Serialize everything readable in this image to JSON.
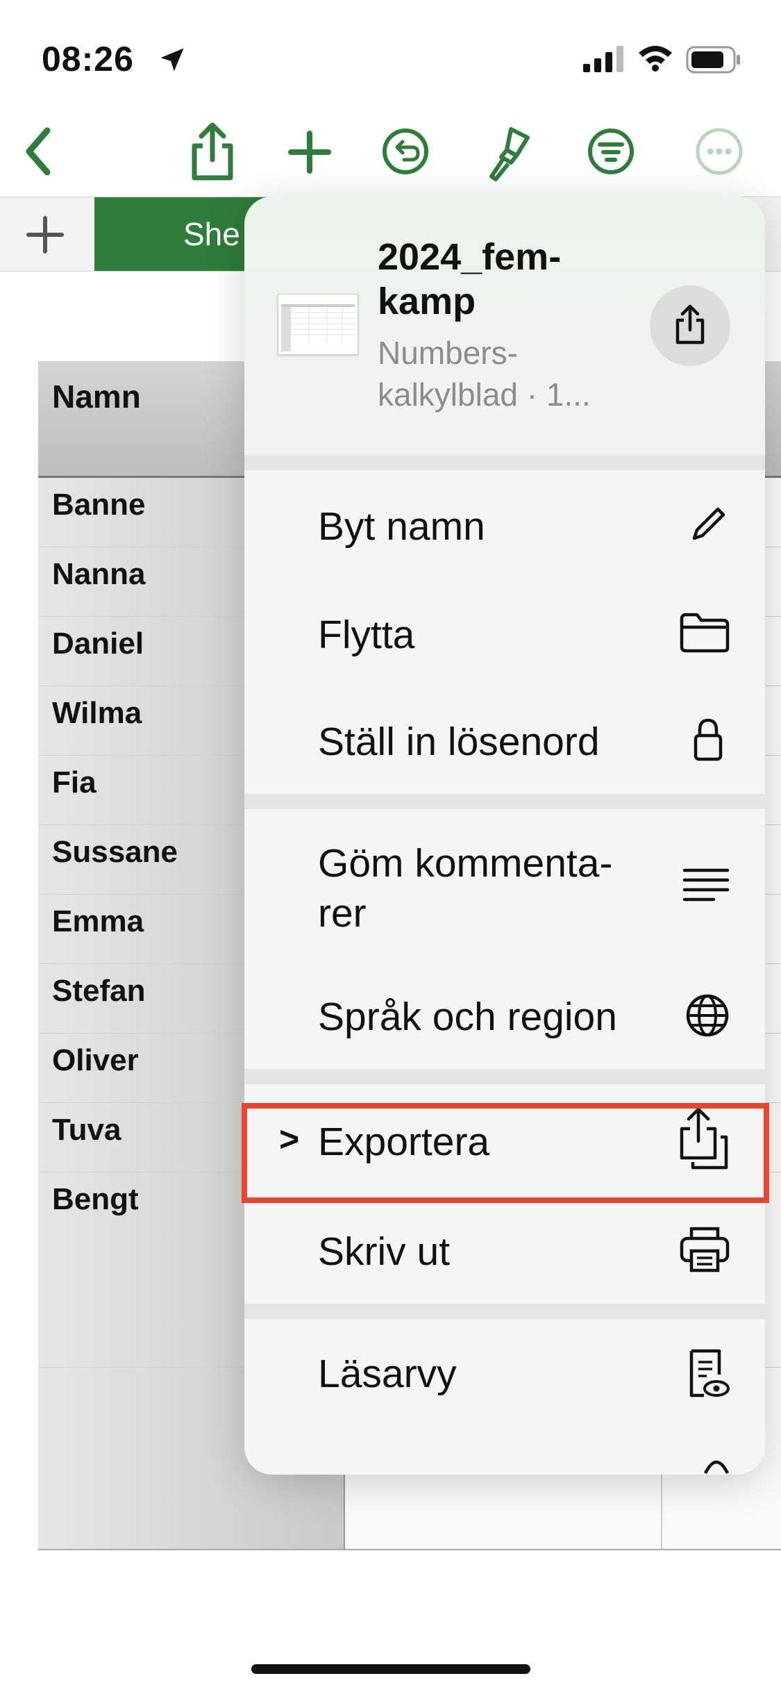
{
  "status": {
    "time": "08:26"
  },
  "toolbar": {
    "back": "chevron-left-icon",
    "share": "share-icon",
    "add": "plus-icon",
    "undo": "undo-icon",
    "format": "paintbrush-icon",
    "organize": "filter-icon",
    "more": "more-icon",
    "accent": "#2e7d3a"
  },
  "tabs": {
    "active_label": "She"
  },
  "table": {
    "header": "Namn",
    "rows": [
      "Banne",
      "Nanna",
      "Daniel",
      "Wilma",
      "Fia",
      "Sussane",
      "Emma",
      "Stefan",
      "Oliver",
      "Tuva",
      "Bengt"
    ]
  },
  "menu": {
    "doc_title": "2024_fem-kamp",
    "doc_title_line1": "2024_fem-",
    "doc_title_line2": "kamp",
    "doc_sub_line1": "Numbers-",
    "doc_sub_line2": "kalkylblad · 1...",
    "items": [
      {
        "label": "Byt namn",
        "icon": "pencil-icon"
      },
      {
        "label": "Flytta",
        "icon": "folder-icon"
      },
      {
        "label": "Ställ in lösenord",
        "icon": "lock-icon"
      },
      {
        "label_line1": "Göm kommenta-",
        "label_line2": "rer",
        "icon": "text-lines-icon"
      },
      {
        "label": "Språk och region",
        "icon": "globe-icon"
      },
      {
        "label": "Exportera",
        "icon": "export-icon",
        "chevron": ">"
      },
      {
        "label": "Skriv ut",
        "icon": "printer-icon"
      },
      {
        "label": "Läsarvy",
        "icon": "reader-view-icon"
      }
    ],
    "highlight_color": "#e8462e"
  }
}
